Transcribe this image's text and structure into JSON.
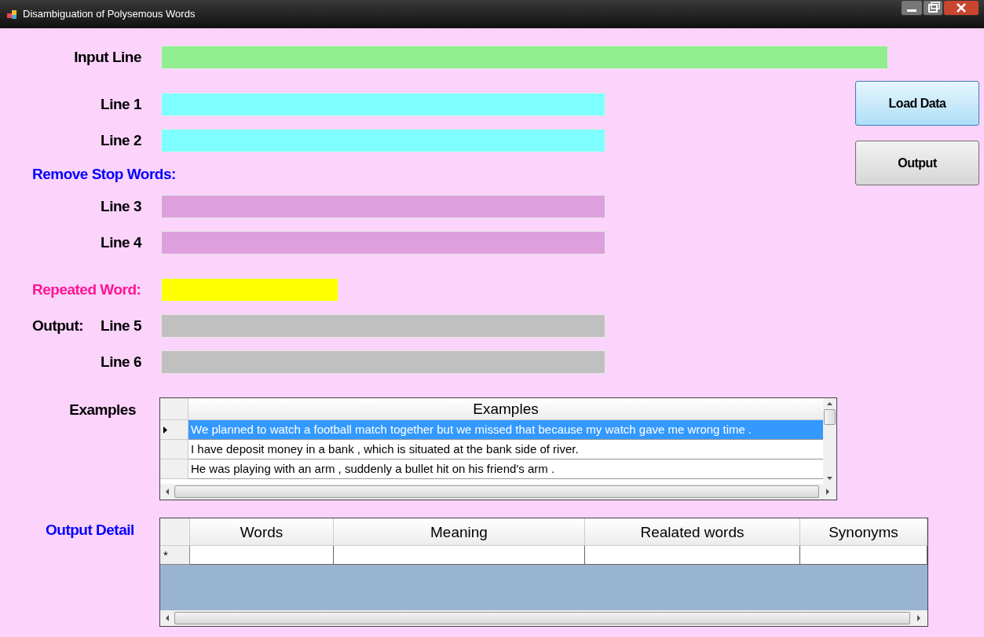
{
  "window": {
    "title": "Disambiguation of Polysemous Words"
  },
  "buttons": [
    {
      "label": "Load Data",
      "kind": "primary"
    },
    {
      "label": "Output",
      "kind": "normal"
    }
  ],
  "form": [
    {
      "kind": "wide",
      "label": "Input Line",
      "color": "#90ee90"
    },
    {
      "kind": "line",
      "label": "Line 1",
      "color": "#7fffff"
    },
    {
      "kind": "line",
      "label": "Line 2",
      "color": "#7fffff"
    },
    {
      "kind": "heading",
      "text": "Remove Stop Words:",
      "color": "#0000ff"
    },
    {
      "kind": "line",
      "label": "Line 3",
      "color": "#dda0dd"
    },
    {
      "kind": "line",
      "label": "Line 4",
      "color": "#dda0dd"
    },
    {
      "kind": "short",
      "caption": {
        "text": "Repeated Word:",
        "color": "#ff1493"
      },
      "color": "#ffff00"
    },
    {
      "kind": "line",
      "prefix": "Output:",
      "label": "Line 5",
      "color": "#c0c0c0"
    },
    {
      "kind": "line",
      "label": "Line 6",
      "color": "#c0c0c0"
    }
  ],
  "examples": {
    "label": "Examples",
    "column": "Examples",
    "rows": [
      {
        "text": "We planned to watch a football match together but we missed that because my watch gave me wrong time .",
        "selected": true
      },
      {
        "text": "I have deposit money in a bank , which is situated at the bank side of river.",
        "selected": false
      },
      {
        "text": "He was playing with an arm , suddenly a bullet hit on his friend's arm .",
        "selected": false
      }
    ]
  },
  "output_detail": {
    "label": "Output Detail",
    "columns": [
      "Words",
      "Meaning",
      "Realated words",
      "Synonyms"
    ],
    "new_row_marker": "*"
  }
}
